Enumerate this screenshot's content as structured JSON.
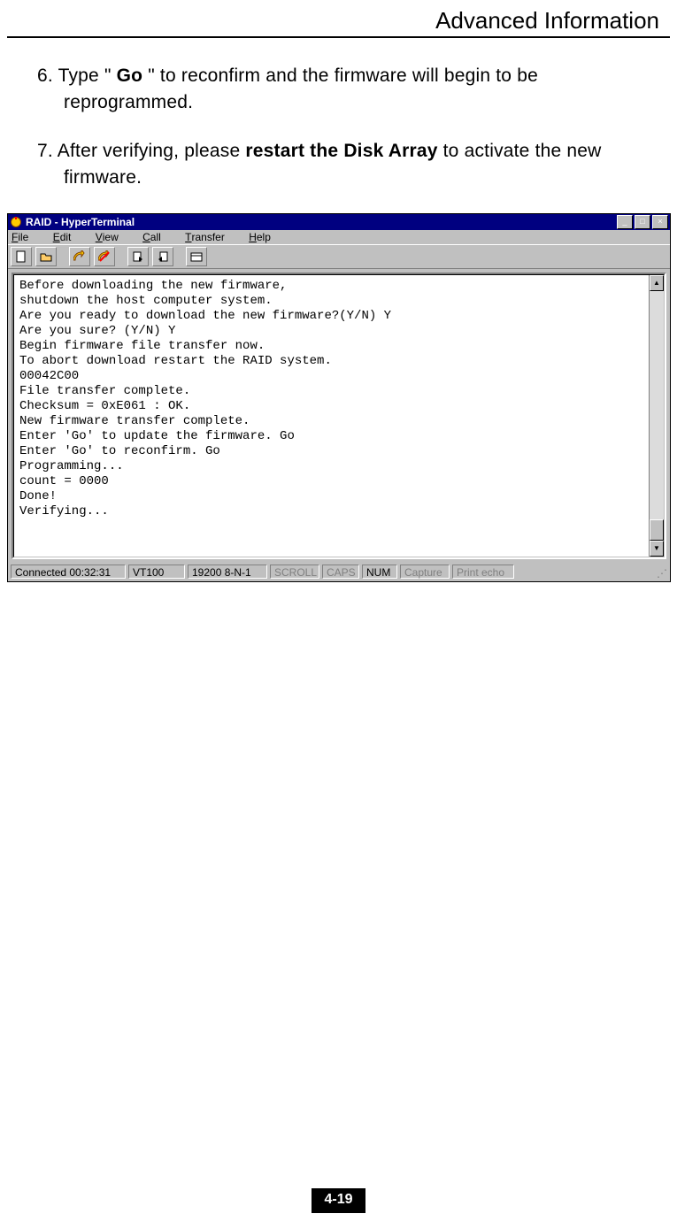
{
  "header": {
    "section_title": "Advanced Information"
  },
  "instructions": {
    "step6": {
      "number": "6. ",
      "pre": "Type \" ",
      "go": "Go",
      "post": " \"  to reconfirm and the firmware will begin to be reprogrammed."
    },
    "step7": {
      "number": "7. ",
      "pre": "After verifying, please ",
      "bold": "restart the Disk Array",
      "post": " to activate the new firmware."
    }
  },
  "window": {
    "title": "RAID - HyperTerminal",
    "controls": {
      "min": "_",
      "max": "□",
      "close": "×"
    },
    "menu": {
      "file": {
        "u": "F",
        "rest": "ile"
      },
      "edit": {
        "u": "E",
        "rest": "dit"
      },
      "view": {
        "u": "V",
        "rest": "iew"
      },
      "call": {
        "u": "C",
        "rest": "all"
      },
      "transfer": {
        "u": "T",
        "rest": "ransfer"
      },
      "help": {
        "u": "H",
        "rest": "elp"
      }
    },
    "scroll": {
      "up": "▲",
      "down": "▼"
    }
  },
  "terminal_lines": [
    "Before downloading the new firmware,",
    "shutdown the host computer system.",
    "Are you ready to download the new firmware?(Y/N) Y",
    "Are you sure? (Y/N) Y",
    "Begin firmware file transfer now.",
    "To abort download restart the RAID system.",
    "00042C00",
    "File transfer complete.",
    "Checksum = 0xE061 : OK.",
    "New firmware transfer complete.",
    "Enter 'Go' to update the firmware. Go",
    "Enter 'Go' to reconfirm. Go",
    "Programming...",
    "count = 0000",
    "Done!",
    "Verifying..."
  ],
  "status": {
    "connected": "Connected 00:32:31",
    "emulation": "VT100",
    "params": "19200 8-N-1",
    "scroll": "SCROLL",
    "caps": "CAPS",
    "num": "NUM",
    "capture": "Capture",
    "printecho": "Print echo"
  },
  "page_number": "4-19"
}
